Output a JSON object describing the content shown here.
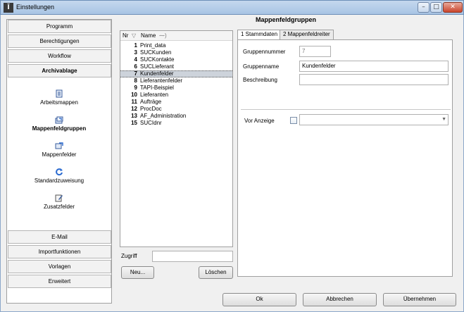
{
  "window": {
    "title": "Einstellungen"
  },
  "nav": {
    "top_buttons": [
      {
        "label": "Programm",
        "bold": false
      },
      {
        "label": "Berechtigungen",
        "bold": false
      },
      {
        "label": "Workflow",
        "bold": false
      },
      {
        "label": "Archivablage",
        "bold": true
      }
    ],
    "items": [
      {
        "label": "Arbeitsmappen",
        "icon": "document-icon",
        "active": false
      },
      {
        "label": "Mappenfeldgruppen",
        "icon": "folder-group-icon",
        "active": true
      },
      {
        "label": "Mappenfelder",
        "icon": "folder-field-icon",
        "active": false
      },
      {
        "label": "Standardzuweisung",
        "icon": "refresh-icon",
        "active": false
      },
      {
        "label": "Zusatzfelder",
        "icon": "edit-icon",
        "active": false
      }
    ],
    "bottom_buttons": [
      {
        "label": "E-Mail"
      },
      {
        "label": "Importfunktionen"
      },
      {
        "label": "Vorlagen"
      },
      {
        "label": "Erweitert"
      }
    ]
  },
  "main": {
    "heading": "Mappenfeldgruppen",
    "list": {
      "col_nr": "Nr",
      "col_name": "Name",
      "rows": [
        {
          "nr": "1",
          "name": "Print_data",
          "selected": false
        },
        {
          "nr": "3",
          "name": "SUCKunden",
          "selected": false
        },
        {
          "nr": "4",
          "name": "SUCKontakte",
          "selected": false
        },
        {
          "nr": "6",
          "name": "SUCLieferant",
          "selected": false
        },
        {
          "nr": "7",
          "name": "Kundenfelder",
          "selected": true
        },
        {
          "nr": "8",
          "name": "Lieferantenfelder",
          "selected": false
        },
        {
          "nr": "9",
          "name": "TAPI-Beispiel",
          "selected": false
        },
        {
          "nr": "10",
          "name": "Lieferanten",
          "selected": false
        },
        {
          "nr": "11",
          "name": "Aufträge",
          "selected": false
        },
        {
          "nr": "12",
          "name": "ProcDoc",
          "selected": false
        },
        {
          "nr": "13",
          "name": "AF_Administration",
          "selected": false
        },
        {
          "nr": "15",
          "name": "SUCIdnr",
          "selected": false
        }
      ]
    },
    "zugriff": {
      "label": "Zugriff",
      "value": ""
    },
    "buttons": {
      "new": "Neu...",
      "delete": "Löschen"
    },
    "tabs": [
      {
        "label": "1 Stammdaten",
        "active": true
      },
      {
        "label": "2 Mappenfeldreiter",
        "active": false
      }
    ],
    "form": {
      "gruppennummer_label": "Gruppennummer",
      "gruppennummer_value": "7",
      "gruppenname_label": "Gruppenname",
      "gruppenname_value": "Kundenfelder",
      "beschreibung_label": "Beschreibung",
      "beschreibung_value": "",
      "vor_anzeige_label": "Vor Anzeige",
      "vor_anzeige_checked": false,
      "vor_anzeige_value": ""
    }
  },
  "footer": {
    "ok": "Ok",
    "cancel": "Abbrechen",
    "apply": "Übernehmen"
  }
}
